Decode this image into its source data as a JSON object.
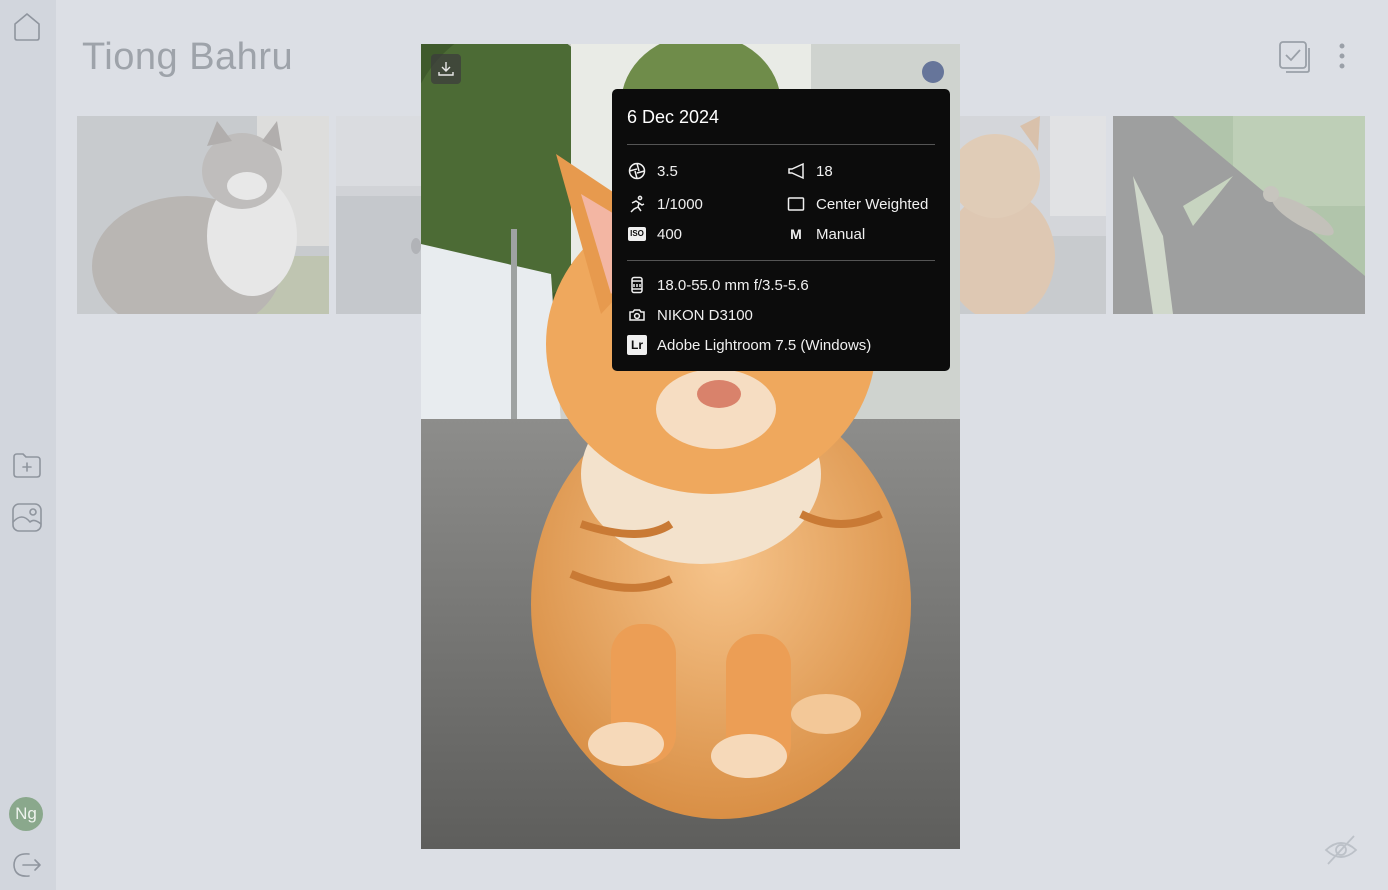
{
  "album": {
    "title": "Tiong Bahru"
  },
  "sidebar": {
    "home": "home-icon",
    "new_album": "folder-plus-icon",
    "gallery": "image-icon",
    "avatar_initials": "Ng",
    "logout": "logout-icon"
  },
  "exif": {
    "date": "6 Dec 2024",
    "aperture": "3.5",
    "focal_length": "18",
    "shutter": "1/1000",
    "metering": "Center Weighted",
    "iso_label": "ISO",
    "iso": "400",
    "mode_label": "M",
    "mode": "Manual",
    "lens": "18.0-55.0 mm f/3.5-5.6",
    "camera": "NIKON D3100",
    "software_label": "Lr",
    "software": "Adobe Lightroom 7.5 (Windows)"
  },
  "colors": {
    "background": "#dcdfe5",
    "sidebar": "#d2d6dd",
    "panel": "#0c0c0c",
    "avatar": "#8aa88c"
  }
}
